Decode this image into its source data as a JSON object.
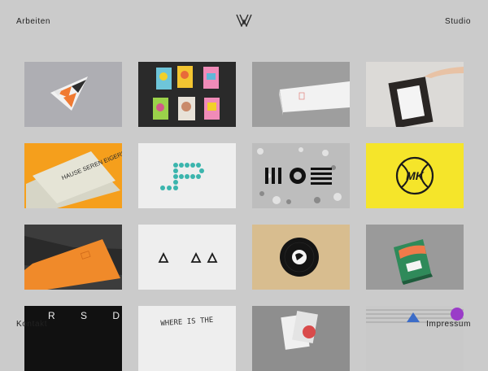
{
  "header": {
    "left_nav": "Arbeiten",
    "right_nav": "Studio",
    "logo_icon": "w-monogram-logo"
  },
  "footer": {
    "left_nav": "Kontakt",
    "right_nav": "Impressum"
  },
  "grid": {
    "tiles": [
      {
        "name": "origami-triangle-logo"
      },
      {
        "name": "poster-wall"
      },
      {
        "name": "white-book-box"
      },
      {
        "name": "framed-artwork"
      },
      {
        "name": "orange-book-cover",
        "text": "HAUSE SEREN EIGERN"
      },
      {
        "name": "dotted-p-letter"
      },
      {
        "name": "gravel-typography"
      },
      {
        "name": "mk-tennis-logo",
        "text": "MK"
      },
      {
        "name": "orange-folder"
      },
      {
        "name": "triangle-marks"
      },
      {
        "name": "vinyl-record"
      },
      {
        "name": "green-book"
      },
      {
        "name": "drsd-lettering",
        "text": "D R S D"
      },
      {
        "name": "handwritten-quote",
        "text": "WHERE IS THE"
      },
      {
        "name": "paper-collage"
      },
      {
        "name": "stadium-photo"
      }
    ]
  }
}
